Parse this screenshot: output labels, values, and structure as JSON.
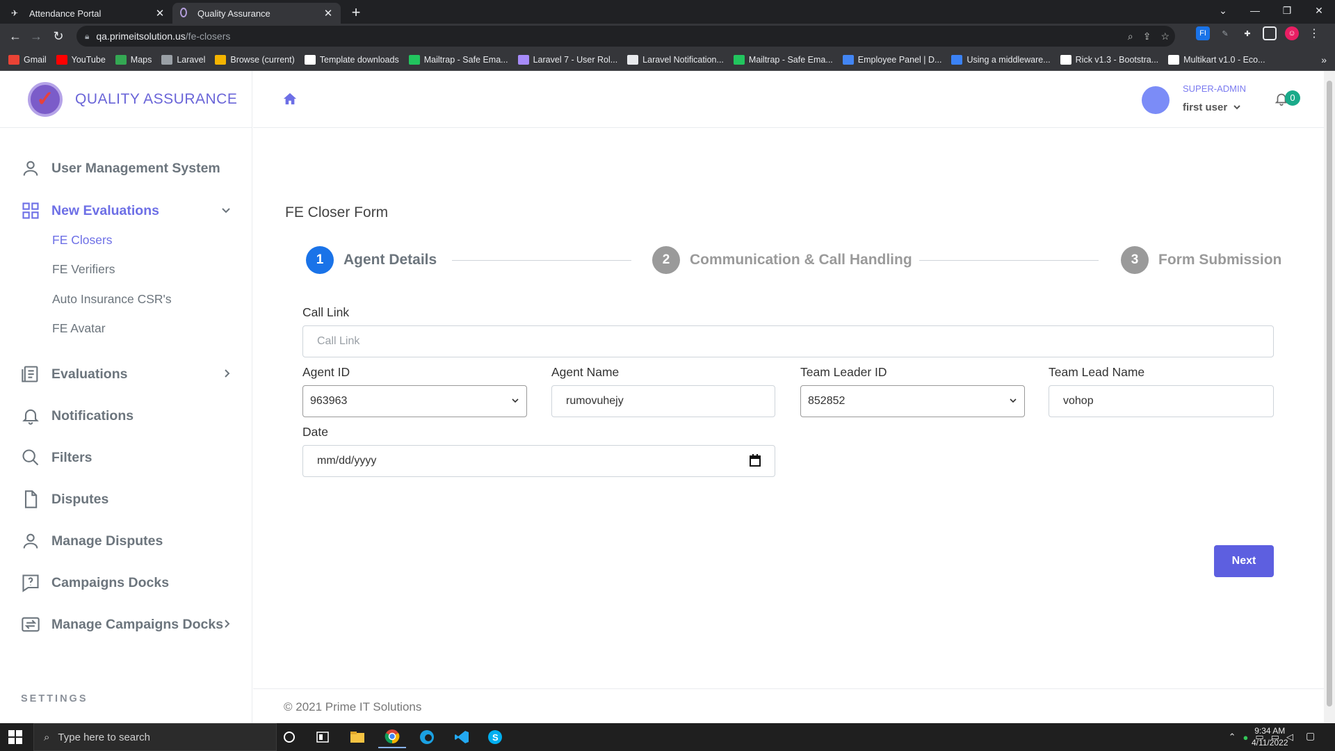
{
  "browser": {
    "tabs": [
      {
        "title": "Attendance Portal",
        "active": false
      },
      {
        "title": "Quality Assurance",
        "active": true
      }
    ],
    "url_host": "qa.primeitsolution.us",
    "url_path": "/fe-closers",
    "bookmarks": [
      {
        "label": "Gmail",
        "icon": "gmail-icon",
        "color": "#ea4335"
      },
      {
        "label": "YouTube",
        "icon": "youtube-icon",
        "color": "#ff0000"
      },
      {
        "label": "Maps",
        "icon": "maps-icon",
        "color": "#34a853"
      },
      {
        "label": "Laravel",
        "icon": "page-icon",
        "color": "#9aa0a6"
      },
      {
        "label": "Browse (current)",
        "icon": "browse-icon",
        "color": "#f4b400"
      },
      {
        "label": "Template downloads",
        "icon": "tl-icon",
        "color": "#ffffff"
      },
      {
        "label": "Mailtrap - Safe Ema...",
        "icon": "mailtrap-icon",
        "color": "#22c55e"
      },
      {
        "label": "Laravel 7 - User Rol...",
        "icon": "page-icon",
        "color": "#a78bfa"
      },
      {
        "label": "Laravel Notification...",
        "icon": "laravel-notification-icon",
        "color": "#e8eaed"
      },
      {
        "label": "Mailtrap - Safe Ema...",
        "icon": "mailtrap-icon",
        "color": "#22c55e"
      },
      {
        "label": "Employee Panel | D...",
        "icon": "w-icon",
        "color": "#4285f4"
      },
      {
        "label": "Using a middleware...",
        "icon": "s-icon",
        "color": "#3b82f6"
      },
      {
        "label": "Rick v1.3 - Bootstra...",
        "icon": "tl-icon",
        "color": "#ffffff"
      },
      {
        "label": "Multikart v1.0 - Eco...",
        "icon": "tl-icon",
        "color": "#ffffff"
      }
    ]
  },
  "app": {
    "brand": "QUALITY ASSURANCE",
    "nav": {
      "user_management": "User Management System",
      "new_evaluations": "New Evaluations",
      "sub_items": [
        "FE Closers",
        "FE Verifiers",
        "Auto Insurance CSR's",
        "FE Avatar"
      ],
      "evaluations": "Evaluations",
      "notifications": "Notifications",
      "filters": "Filters",
      "disputes": "Disputes",
      "manage_disputes": "Manage Disputes",
      "campaigns_docks": "Campaigns Docks",
      "manage_campaigns_docks": "Manage Campaigns Docks",
      "settings_label": "SETTINGS"
    },
    "user": {
      "role": "SUPER-ADMIN",
      "name": "first user",
      "notification_count": "0"
    },
    "form": {
      "title": "FE Closer Form",
      "steps": [
        {
          "num": "1",
          "label": "Agent Details",
          "active": true
        },
        {
          "num": "2",
          "label": "Communication & Call Handling",
          "active": false
        },
        {
          "num": "3",
          "label": "Form Submission",
          "active": false
        }
      ],
      "call_link_label": "Call Link",
      "call_link_placeholder": "Call Link",
      "agent_id_label": "Agent ID",
      "agent_id_value": "963963",
      "agent_name_label": "Agent Name",
      "agent_name_value": "rumovuhejy",
      "team_leader_id_label": "Team Leader ID",
      "team_leader_id_value": "852852",
      "team_lead_name_label": "Team Lead Name",
      "team_lead_name_value": "vohop",
      "date_label": "Date",
      "date_placeholder": "mm/dd/yyyy",
      "next_label": "Next"
    },
    "footer": "© 2021 Prime IT Solutions"
  },
  "taskbar": {
    "search_placeholder": "Type here to search",
    "time": "9:34 AM",
    "date": "4/11/2022"
  },
  "colors": {
    "accent": "#5d5fe0",
    "step_active": "#1a73e8",
    "step_inactive": "#9a9a9a",
    "badge": "#1aaa8a"
  }
}
